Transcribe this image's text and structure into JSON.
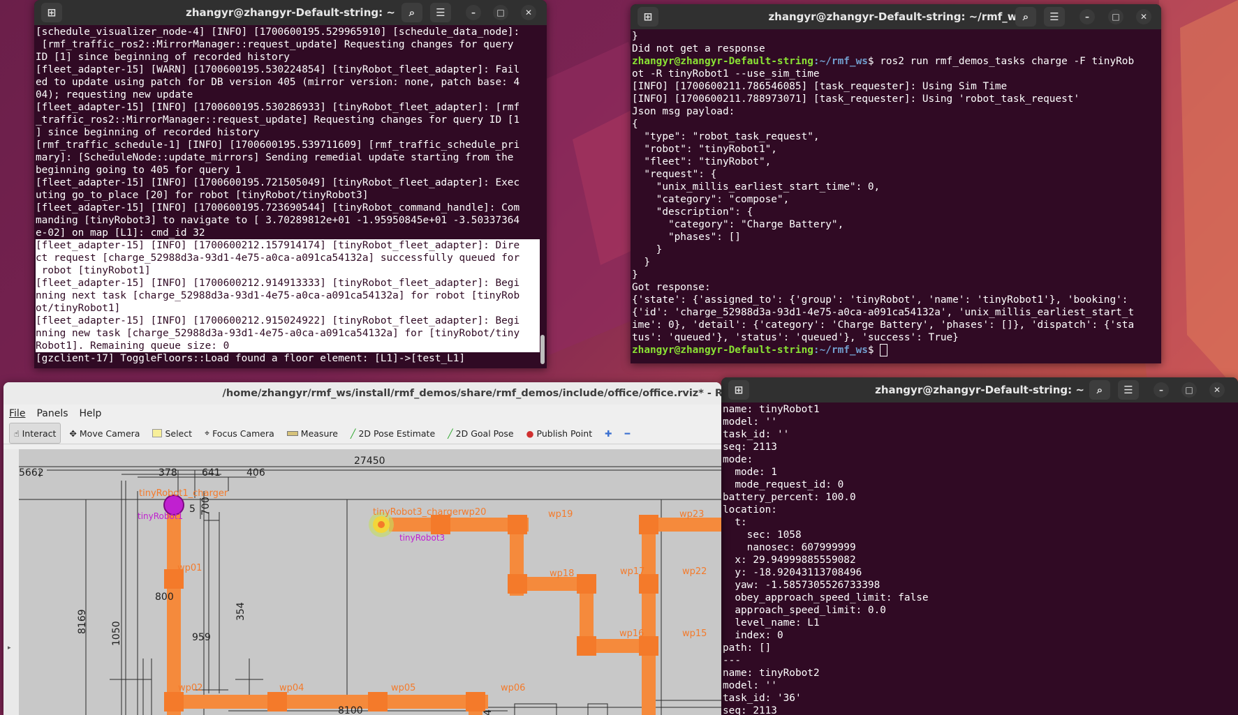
{
  "term1": {
    "title": "zhangyr@zhangyr-Default-string: ~",
    "lines": [
      "[schedule_visualizer_node-4] [INFO] [1700600195.529965910] [schedule_data_node]:",
      " [rmf_traffic_ros2::MirrorManager::request_update] Requesting changes for query",
      "ID [1] since beginning of recorded history",
      "[fleet_adapter-15] [WARN] [1700600195.530224854] [tinyRobot_fleet_adapter]: Fail",
      "ed to update using patch for DB version 405 (mirror version: none, patch base: 4",
      "04); requesting new update",
      "[fleet_adapter-15] [INFO] [1700600195.530286933] [tinyRobot_fleet_adapter]: [rmf",
      "_traffic_ros2::MirrorManager::request_update] Requesting changes for query ID [1",
      "] since beginning of recorded history",
      "[rmf_traffic_schedule-1] [INFO] [1700600195.539711609] [rmf_traffic_schedule_pri",
      "mary]: [ScheduleNode::update_mirrors] Sending remedial update starting from the",
      "beginning going to 405 for query 1",
      "[fleet_adapter-15] [INFO] [1700600195.721505049] [tinyRobot_fleet_adapter]: Exec",
      "uting go_to_place [20] for robot [tinyRobot/tinyRobot3]",
      "[fleet_adapter-15] [INFO] [1700600195.723690544] [tinyRobot_command_handle]: Com",
      "manding [tinyRobot3] to navigate to [ 3.70289812e+01 -1.95950845e+01 -3.50337364",
      "e-02] on map [L1]: cmd_id 32"
    ],
    "selected_lines": [
      "[fleet_adapter-15] [INFO] [1700600212.157914174] [tinyRobot_fleet_adapter]: Dire",
      "ct request [charge_52988d3a-93d1-4e75-a0ca-a091ca54132a] successfully queued for",
      " robot [tinyRobot1]",
      "[fleet_adapter-15] [INFO] [1700600212.914913333] [tinyRobot_fleet_adapter]: Begi",
      "nning next task [charge_52988d3a-93d1-4e75-a0ca-a091ca54132a] for robot [tinyRob",
      "ot/tinyRobot1]",
      "[fleet_adapter-15] [INFO] [1700600212.915024922] [tinyRobot_fleet_adapter]: Begi",
      "nning new task [charge_52988d3a-93d1-4e75-a0ca-a091ca54132a] for [tinyRobot/tiny",
      "Robot1]. Remaining queue size: 0"
    ],
    "last_line": "[gzclient-17] ToggleFloors::Load found a floor element: [L1]->[test_L1]"
  },
  "term2": {
    "title": "zhangyr@zhangyr-Default-string: ~/rmf_ws",
    "line_a": "}",
    "line_b": "Did not get a response",
    "prompt_user": "zhangyr@zhangyr-Default-string",
    "prompt_path": ":~/rmf_ws",
    "prompt_end": "$ ",
    "command_1": "ros2 run rmf_demos_tasks charge -F tinyRob",
    "command_2": "ot -R tinyRobot1 --use_sim_time",
    "lines": [
      "[INFO] [1700600211.786546085] [task_requester]: Using Sim Time",
      "[INFO] [1700600211.788973071] [task_requester]: Using 'robot_task_request'",
      "Json msg payload:",
      "{",
      "  \"type\": \"robot_task_request\",",
      "  \"robot\": \"tinyRobot1\",",
      "  \"fleet\": \"tinyRobot\",",
      "  \"request\": {",
      "    \"unix_millis_earliest_start_time\": 0,",
      "    \"category\": \"compose\",",
      "    \"description\": {",
      "      \"category\": \"Charge Battery\",",
      "      \"phases\": []",
      "    }",
      "  }",
      "}",
      "Got response:",
      "{'state': {'assigned_to': {'group': 'tinyRobot', 'name': 'tinyRobot1'}, 'booking':",
      "{'id': 'charge_52988d3a-93d1-4e75-a0ca-a091ca54132a', 'unix_millis_earliest_start_t",
      "ime': 0}, 'detail': {'category': 'Charge Battery', 'phases': []}, 'dispatch': {'sta",
      "tus': 'queued'}, 'status': 'queued'}, 'success': True}"
    ]
  },
  "term3": {
    "title": "zhangyr@zhangyr-Default-string: ~",
    "lines": [
      "name: tinyRobot1",
      "model: ''",
      "task_id: ''",
      "seq: 2113",
      "mode:",
      "  mode: 1",
      "  mode_request_id: 0",
      "battery_percent: 100.0",
      "location:",
      "  t:",
      "    sec: 1058",
      "    nanosec: 607999999",
      "  x: 29.94999885559082",
      "  y: -18.92043113708496",
      "  yaw: -1.5857305526733398",
      "  obey_approach_speed_limit: false",
      "  approach_speed_limit: 0.0",
      "  level_name: L1",
      "  index: 0",
      "path: []",
      "---",
      "name: tinyRobot2",
      "model: ''",
      "task_id: '36'",
      "seq: 2113"
    ]
  },
  "rviz": {
    "title": "/home/zhangyr/rmf_ws/install/rmf_demos/share/rmf_demos/include/office/office.rviz* - RViz",
    "menu": [
      "File",
      "Panels",
      "Help"
    ],
    "tools": {
      "interact": "Interact",
      "move_camera": "Move Camera",
      "select": "Select",
      "focus_camera": "Focus Camera",
      "measure": "Measure",
      "pose_estimate": "2D Pose Estimate",
      "goal_pose": "2D Goal Pose",
      "publish_point": "Publish Point"
    },
    "map": {
      "dims": {
        "total": "27450",
        "d5662": "5662",
        "d378": "378",
        "d641": "641",
        "d406": "406",
        "d700": "700",
        "d5": "5",
        "d800": "800",
        "d8169": "8169",
        "d1050": "1050",
        "d959": "959",
        "d354": "354",
        "d8100": "8100",
        "d4": "4"
      },
      "labels": {
        "charger1": "tinyRobot1_charger",
        "robot1": "tinyRobot1",
        "charger3": "tinyRobot3_charger",
        "wp20": "wp20",
        "robot3": "tinyRobot3",
        "wp19": "wp19",
        "wp23": "wp23",
        "wp01": "wp01",
        "wp18": "wp18",
        "wp17": "wp17",
        "wp22": "wp22",
        "wp16": "wp16",
        "wp15": "wp15",
        "wp02": "wp02",
        "wp04": "wp04",
        "wp05": "wp05",
        "wp06": "wp06"
      },
      "colors": {
        "lane": "#f58a3c",
        "robot1": "#c020d0",
        "robot3": "#f2d63a",
        "floor": "#c8c8c8"
      }
    }
  }
}
